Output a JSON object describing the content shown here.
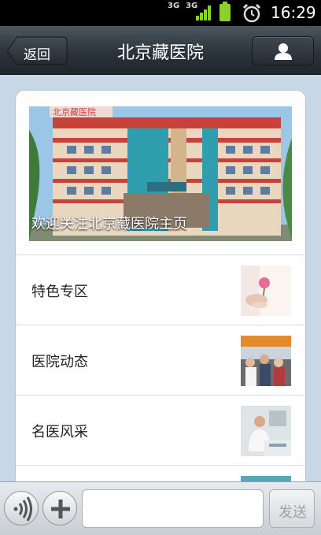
{
  "status_bar": {
    "network_1": "3G",
    "network_2": "3G",
    "time": "16:29",
    "icons": [
      "signal-icon",
      "battery-icon",
      "alarm-clock-icon"
    ]
  },
  "header": {
    "back_label": "返回",
    "title": "北京藏医院",
    "user_icon": "person-icon"
  },
  "banner": {
    "caption": "欢迎关注北京藏医院主页",
    "sign_text": "北京藏医院"
  },
  "menu": {
    "items": [
      {
        "label": "特色专区"
      },
      {
        "label": "医院动态"
      },
      {
        "label": "名医风采"
      }
    ]
  },
  "input_bar": {
    "voice_icon": "voice-icon",
    "plus_icon": "plus-icon",
    "text_value": "",
    "send_label": "发送"
  },
  "colors": {
    "title_bar": "#2b333b",
    "background": "#c8d7e6",
    "battery": "#8ad12b"
  }
}
